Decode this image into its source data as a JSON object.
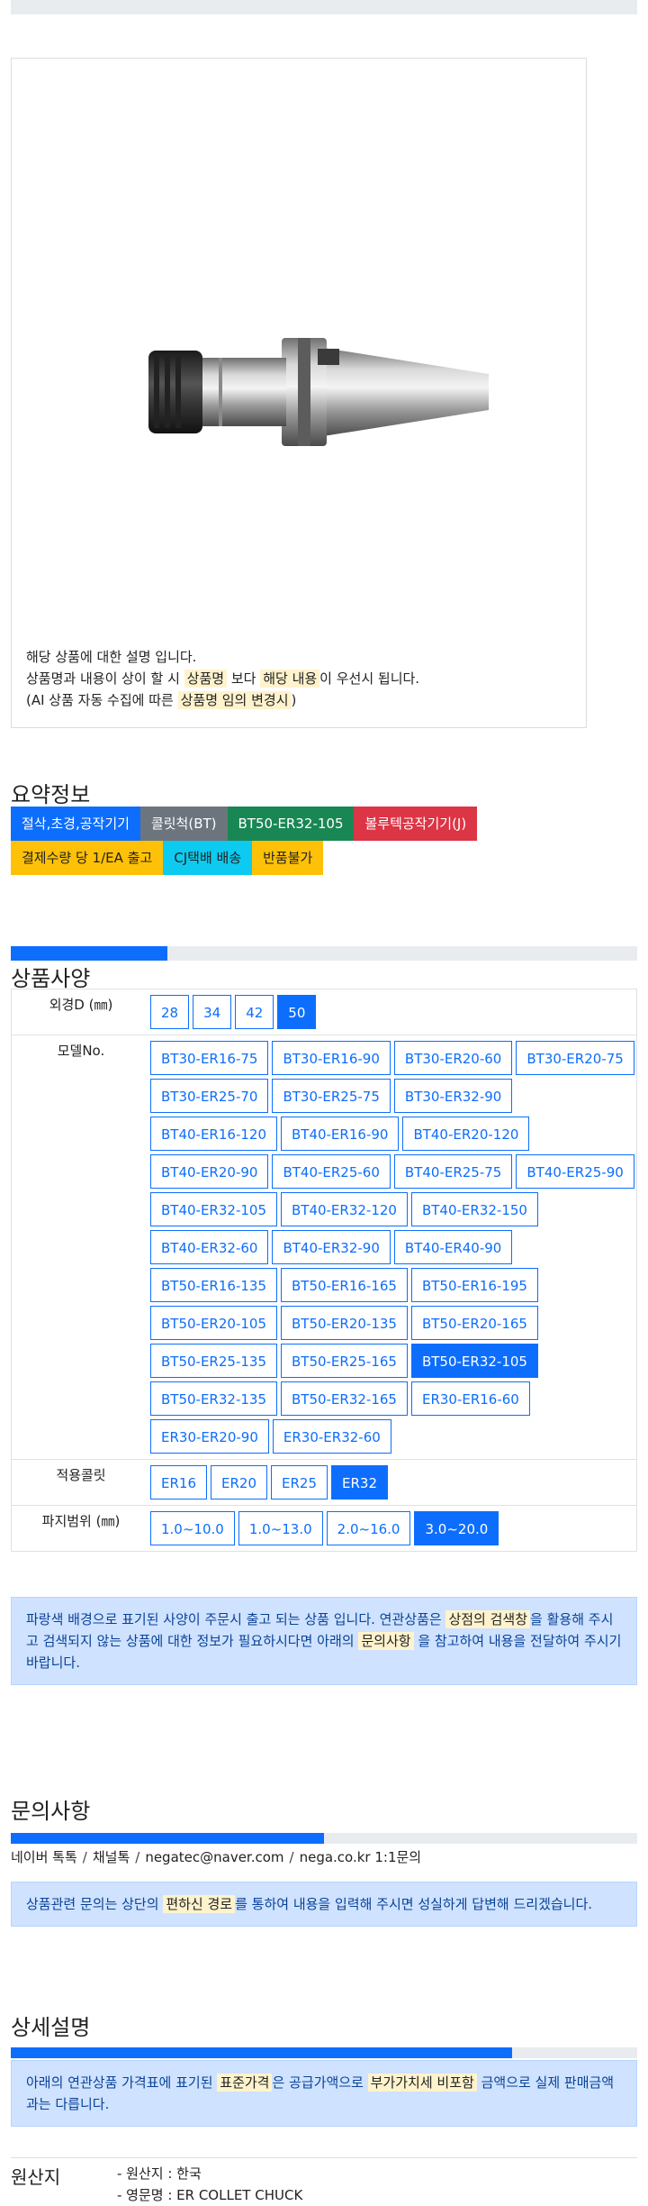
{
  "description": {
    "line1": "해당 상품에 대한 설명 입니다.",
    "line2_pre": "상품명과 내용이 상이 할 시 ",
    "line2_hl1": "상품명",
    "line2_mid": " 보다 ",
    "line2_hl2": "해당 내용",
    "line2_post": "이 우선시 됩니다.",
    "line3_pre": "(AI 상품 자동 수집에 따른 ",
    "line3_hl": "상품명 임의 변경시",
    "line3_post": ")"
  },
  "summary": {
    "title": "요약정보",
    "tags_row1": [
      "절삭,초경,공작기기",
      "콜릿척(BT)",
      "BT50-ER32-105",
      "볼루텍공작기기(J)"
    ],
    "tags_row2": [
      "결제수량 당 1/EA 출고",
      "CJ택배 배송",
      "반품불가"
    ]
  },
  "spec": {
    "progress": 0.25,
    "title": "상품사양",
    "outer_label": "외경D (㎜)",
    "outer_options": [
      "28",
      "34",
      "42",
      "50"
    ],
    "outer_selected": "50",
    "model_label": "모델No.",
    "model_options": [
      "BT30-ER16-75",
      "BT30-ER16-90",
      "BT30-ER20-60",
      "BT30-ER20-75",
      "BT30-ER25-70",
      "BT30-ER25-75",
      "BT30-ER32-90",
      "BT40-ER16-120",
      "BT40-ER16-90",
      "BT40-ER20-120",
      "BT40-ER20-90",
      "BT40-ER25-60",
      "BT40-ER25-75",
      "BT40-ER25-90",
      "BT40-ER32-105",
      "BT40-ER32-120",
      "BT40-ER32-150",
      "BT40-ER32-60",
      "BT40-ER32-90",
      "BT40-ER40-90",
      "BT50-ER16-135",
      "BT50-ER16-165",
      "BT50-ER16-195",
      "BT50-ER20-105",
      "BT50-ER20-135",
      "BT50-ER20-165",
      "BT50-ER25-135",
      "BT50-ER25-165",
      "BT50-ER32-105",
      "BT50-ER32-135",
      "BT50-ER32-165",
      "ER30-ER16-60",
      "ER30-ER20-90",
      "ER30-ER32-60"
    ],
    "model_selected": "BT50-ER32-105",
    "collet_label": "적용콜릿",
    "collet_options": [
      "ER16",
      "ER20",
      "ER25",
      "ER32"
    ],
    "collet_selected": "ER32",
    "grip_label": "파지범위 (㎜)",
    "grip_options": [
      "1.0~10.0",
      "1.0~13.0",
      "2.0~16.0",
      "3.0~20.0"
    ],
    "grip_selected": "3.0~20.0",
    "notice_pre": "파랑색 배경으로 표기된 사양이 주문시 출고 되는 상품 입니다. 연관상품은 ",
    "notice_hl1": "상점의 검색창",
    "notice_mid": "을 활용해 주시고 검색되지 않는 상품에 대한 정보가 필요하시다면 아래의 ",
    "notice_hl2": "문의사항",
    "notice_post": " 을 참고하여 내용을 전달하여 주시기 바랍니다."
  },
  "inquiry": {
    "title": "문의사항",
    "progress": 0.5,
    "contacts": [
      "네이버 톡톡",
      "채널톡",
      "negatec@naver.com",
      "nega.co.kr 1:1문의"
    ],
    "notice_pre": "상품관련 문의는 상단의 ",
    "notice_hl": "편하신 경로",
    "notice_post": "를 통하여 내용을 입력해 주시면 성실하게 답변해 드리겠습니다."
  },
  "detail": {
    "title": "상세설명",
    "progress": 0.8,
    "notice_pre": "아래의 연관상품 가격표에 표기된 ",
    "notice_hl1": "표준가격",
    "notice_mid": "은 공급가액으로 ",
    "notice_hl2": "부가가치세 비포함",
    "notice_post": " 금액으로 실제 판매금액과는 다릅니다."
  },
  "origin": {
    "label": "원산지",
    "items": [
      "- 원산지 : 한국",
      "- 영문명 : ER COLLET CHUCK"
    ]
  },
  "colors": {
    "primary": "#0d6efd",
    "alert_bg": "#cfe2ff",
    "highlight": "#fff3cd"
  }
}
